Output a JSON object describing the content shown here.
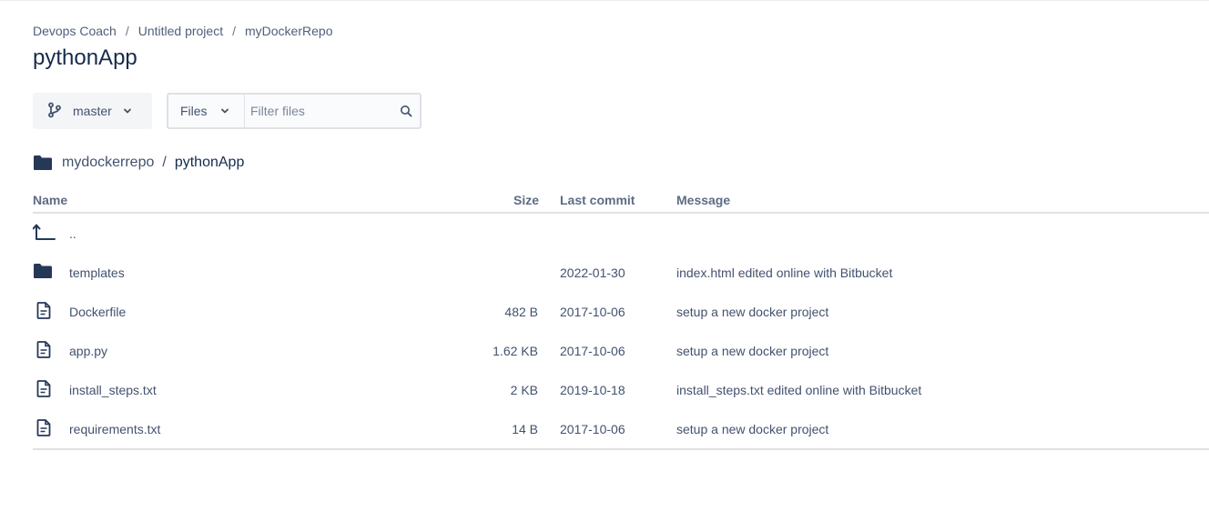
{
  "breadcrumbs": [
    {
      "label": "Devops Coach"
    },
    {
      "label": "Untitled project"
    },
    {
      "label": "myDockerRepo"
    }
  ],
  "title": "pythonApp",
  "toolbar": {
    "branch": "master",
    "filter_type": "Files",
    "filter_placeholder": "Filter files"
  },
  "path": {
    "repo": "mydockerrepo",
    "current": "pythonApp"
  },
  "table": {
    "headers": {
      "name": "Name",
      "size": "Size",
      "last_commit": "Last commit",
      "message": "Message"
    },
    "parent": "..",
    "rows": [
      {
        "type": "folder",
        "name": "templates",
        "size": "",
        "date": "2022-01-30",
        "message": "index.html edited online with Bitbucket"
      },
      {
        "type": "file",
        "name": "Dockerfile",
        "size": "482 B",
        "date": "2017-10-06",
        "message": "setup a new docker project"
      },
      {
        "type": "file",
        "name": "app.py",
        "size": "1.62 KB",
        "date": "2017-10-06",
        "message": "setup a new docker project"
      },
      {
        "type": "file",
        "name": "install_steps.txt",
        "size": "2 KB",
        "date": "2019-10-18",
        "message": "install_steps.txt edited online with Bitbucket"
      },
      {
        "type": "file",
        "name": "requirements.txt",
        "size": "14 B",
        "date": "2017-10-06",
        "message": "setup a new docker project"
      }
    ]
  },
  "colors": {
    "text_primary": "#172b4d",
    "text_secondary": "#42526e",
    "border": "#dfe1e6",
    "folder_icon": "#253858"
  },
  "icons": {
    "branch": "branch-icon",
    "chevron": "chevron-down-icon",
    "search": "search-icon",
    "folder": "folder-icon",
    "file": "file-icon",
    "parent": "parent-directory-icon"
  }
}
